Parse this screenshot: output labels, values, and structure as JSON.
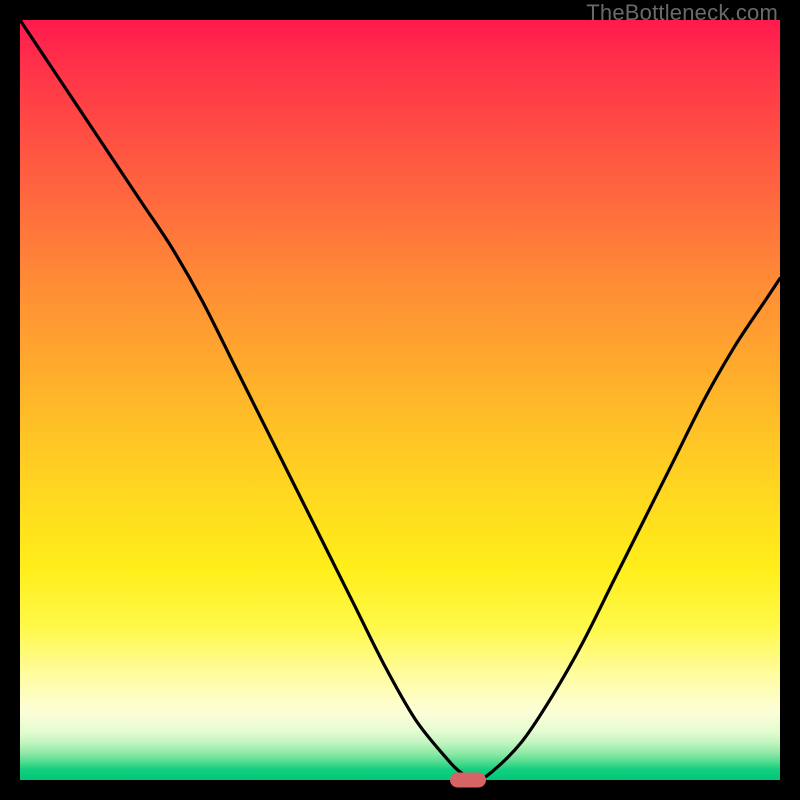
{
  "watermark": "TheBottleneck.com",
  "colors": {
    "frame": "#000000",
    "curve": "#000000",
    "marker": "#d66464"
  },
  "chart_data": {
    "type": "line",
    "title": "",
    "xlabel": "",
    "ylabel": "",
    "xlim": [
      0,
      100
    ],
    "ylim": [
      0,
      100
    ],
    "grid": false,
    "background": "red-yellow-green vertical gradient (bottleneck heatmap)",
    "series": [
      {
        "name": "bottleneck-curve",
        "x": [
          0,
          4,
          8,
          12,
          16,
          20,
          24,
          28,
          32,
          36,
          40,
          44,
          48,
          52,
          56,
          58,
          60,
          62,
          66,
          70,
          74,
          78,
          82,
          86,
          90,
          94,
          98,
          100
        ],
        "y": [
          100,
          94,
          88,
          82,
          76,
          70,
          63,
          55,
          47,
          39,
          31,
          23,
          15,
          8,
          3,
          1,
          0,
          1,
          5,
          11,
          18,
          26,
          34,
          42,
          50,
          57,
          63,
          66
        ]
      }
    ],
    "marker": {
      "x": 59,
      "y": 0,
      "label": "optimal-point"
    },
    "legend": null
  }
}
